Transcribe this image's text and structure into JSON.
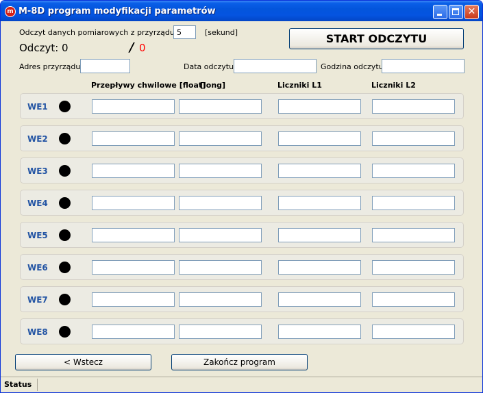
{
  "window": {
    "title": "M-8D program modyfikacji parametrów",
    "icon_text": "m",
    "minimize_icon": "minimize-icon",
    "maximize_icon": "maximize-icon",
    "close_icon": "close-icon"
  },
  "reading": {
    "interval_label": "Odczyt danych pomiarowych z przyrządu co:",
    "interval_value": "5",
    "interval_unit": "[sekund]",
    "count_label": "Odczyt: 0",
    "separator": "/",
    "error_count": "0",
    "error_color": "#ff0000",
    "start_button": "START ODCZYTU"
  },
  "fields": {
    "address_label": "Adres przyrządu:",
    "address_value": "",
    "date_label": "Data odczytu:",
    "date_value": "",
    "time_label": "Godzina odczytu:",
    "time_value": ""
  },
  "headers": {
    "flow": "Przepływy chwilowe [float]",
    "long": "[long]",
    "l1": "Liczniki L1",
    "l2": "Liczniki L2"
  },
  "rows": [
    {
      "label": "WE1"
    },
    {
      "label": "WE2"
    },
    {
      "label": "WE3"
    },
    {
      "label": "WE4"
    },
    {
      "label": "WE5"
    },
    {
      "label": "WE6"
    },
    {
      "label": "WE7"
    },
    {
      "label": "WE8"
    }
  ],
  "buttons": {
    "back": "<  Wstecz",
    "exit": "Zakończ program"
  },
  "status": {
    "text": "Status"
  }
}
